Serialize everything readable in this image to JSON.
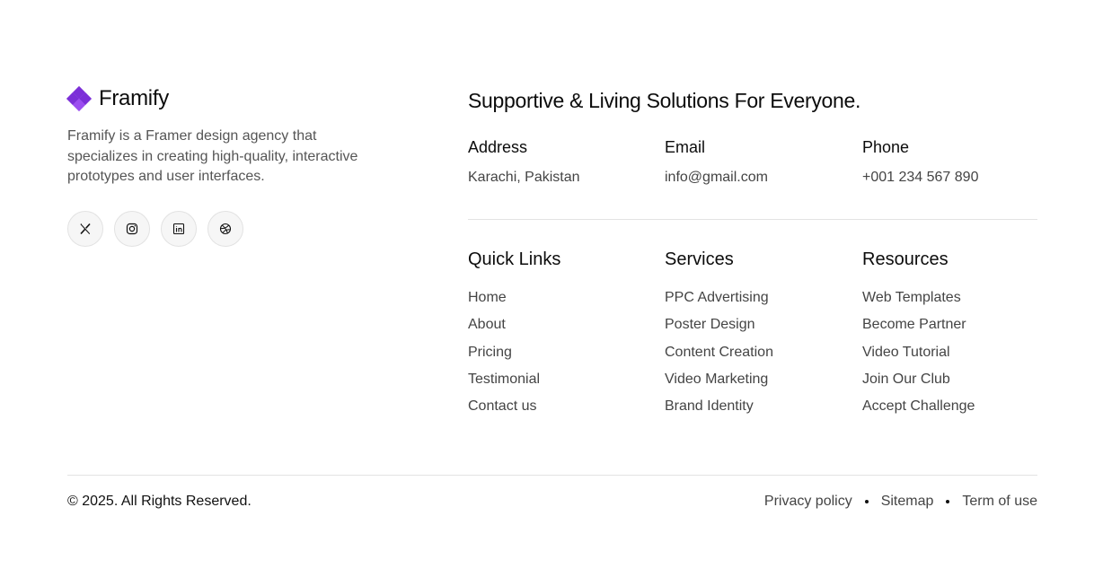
{
  "brand": {
    "name": "Framify",
    "description": "Framify is a Framer design agency that specializes in creating high-quality, interactive prototypes and user interfaces.",
    "accent_color": "#7c2fd8"
  },
  "socials": [
    {
      "icon": "x-icon"
    },
    {
      "icon": "instagram-icon"
    },
    {
      "icon": "linkedin-icon"
    },
    {
      "icon": "dribbble-icon"
    }
  ],
  "headline": "Supportive & Living Solutions For Everyone.",
  "contact": {
    "address": {
      "label": "Address",
      "value": "Karachi, Pakistan"
    },
    "email": {
      "label": "Email",
      "value": "info@gmail.com"
    },
    "phone": {
      "label": "Phone",
      "value": "+001 234 567 890"
    }
  },
  "quick_links": {
    "title": "Quick Links",
    "items": [
      "Home",
      "About",
      "Pricing",
      "Testimonial",
      "Contact us"
    ]
  },
  "services": {
    "title": "Services",
    "items": [
      "PPC Advertising",
      "Poster Design",
      "Content Creation",
      "Video Marketing",
      "Brand Identity"
    ]
  },
  "resources": {
    "title": "Resources",
    "items": [
      "Web Templates",
      "Become Partner",
      "Video Tutorial",
      "Join Our Club",
      "Accept Challenge"
    ]
  },
  "footer": {
    "copyright": "© 2025.  All Rights Reserved.",
    "privacy": "Privacy policy",
    "sitemap": "Sitemap",
    "terms": "Term of use"
  }
}
